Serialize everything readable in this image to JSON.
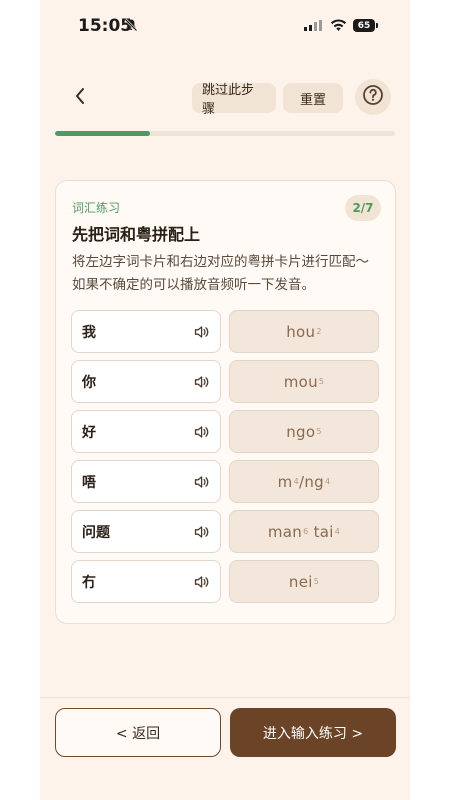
{
  "status_bar": {
    "time": "15:05",
    "battery": "65"
  },
  "nav": {
    "skip_label": "跳过此步骤",
    "reset_label": "重置",
    "progress_fraction": 0.28
  },
  "card": {
    "tag": "词汇练习",
    "counter": "2/7",
    "title": "先把词和粤拼配上",
    "description": "将左边字词卡片和右边对应的粤拼卡片进行匹配～ 如果不确定的可以播放音频听一下发音。",
    "words": [
      "我",
      "你",
      "好",
      "唔",
      "问题",
      "冇"
    ],
    "jyutping": [
      [
        {
          "base": "hou",
          "tone": "2"
        }
      ],
      [
        {
          "base": "mou",
          "tone": "5"
        }
      ],
      [
        {
          "base": "ngo",
          "tone": "5"
        }
      ],
      [
        {
          "base": "m",
          "tone": "4",
          "sep": "/"
        },
        {
          "base": "ng",
          "tone": "4"
        }
      ],
      [
        {
          "base": "man",
          "tone": "6",
          "sep": " "
        },
        {
          "base": "tai",
          "tone": "4"
        }
      ],
      [
        {
          "base": "nei",
          "tone": "5"
        }
      ]
    ]
  },
  "footer": {
    "back_label": "< 返回",
    "next_label": "进入输入练习 >"
  },
  "colors": {
    "accent_green": "#4f9a64",
    "brand_brown": "#6b4427",
    "background": "#fdf3ea"
  },
  "icons": {
    "back": "chevron-left-icon",
    "help": "question-circle-icon",
    "audio": "speaker-icon",
    "silent": "bell-slash-icon"
  }
}
